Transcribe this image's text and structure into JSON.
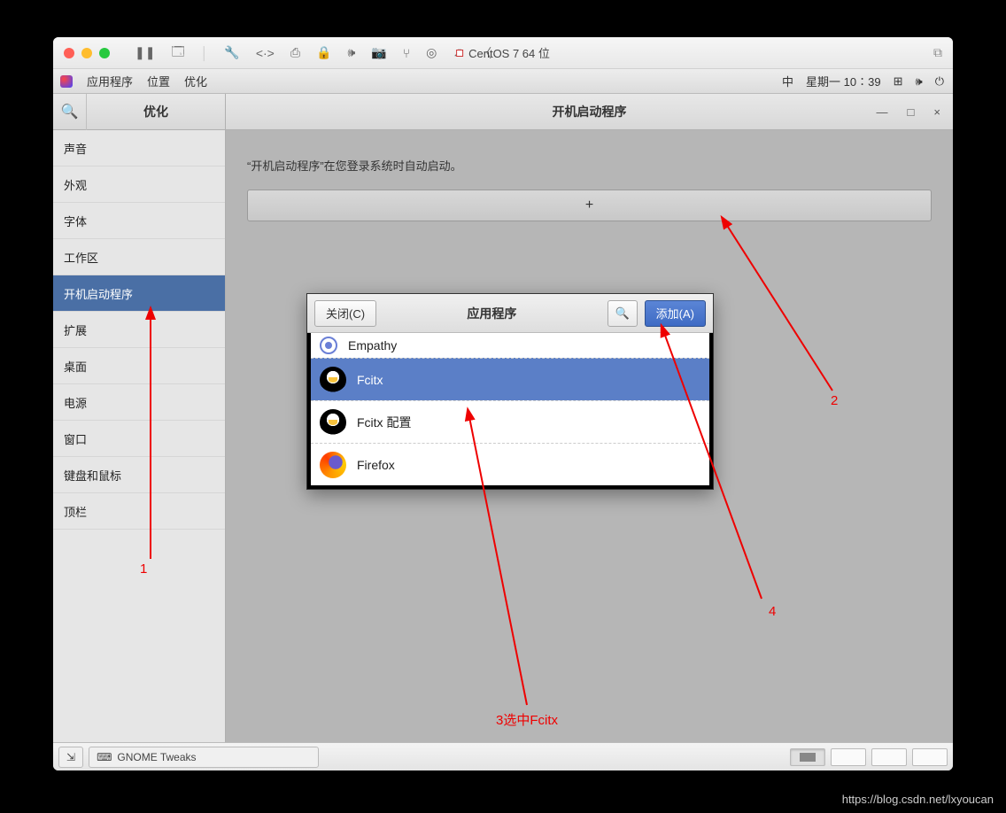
{
  "mac_toolbar": {
    "title": "CentOS 7 64 位",
    "icons": [
      "pause",
      "snapshot",
      "sep",
      "wrench",
      "code",
      "print",
      "lock",
      "sound",
      "camera",
      "usb",
      "disc",
      "share",
      "back"
    ]
  },
  "gnome_top": {
    "menu1": "应用程序",
    "menu2": "位置",
    "menu3": "优化",
    "ime": "中",
    "clock": "星期一 10∶39"
  },
  "tweaks": {
    "sidebar_title": "优化",
    "header_title": "开机启动程序",
    "min": "—",
    "max": "□",
    "close": "×",
    "items": [
      "声音",
      "外观",
      "字体",
      "工作区",
      "开机启动程序",
      "扩展",
      "桌面",
      "电源",
      "窗口",
      "键盘和鼠标",
      "顶栏"
    ],
    "selected_index": 4,
    "hint": "“开机启动程序”在您登录系统时自动启动。",
    "add_label": "+"
  },
  "dialog": {
    "close": "关闭(C)",
    "title": "应用程序",
    "add": "添加(A)",
    "apps": [
      "Empathy",
      "Fcitx",
      "Fcitx 配置",
      "Firefox"
    ],
    "selected_index": 1
  },
  "taskbar": {
    "app": "GNOME Tweaks"
  },
  "annotations": {
    "a1": "1",
    "a2": "2",
    "a3": "3选中Fcitx",
    "a4": "4"
  },
  "watermark": "https://blog.csdn.net/lxyoucan"
}
